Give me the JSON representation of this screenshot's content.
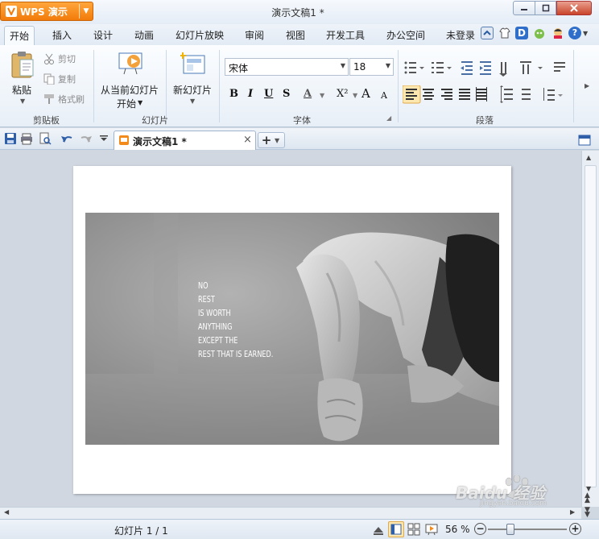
{
  "app": {
    "name": "WPS 演示",
    "doc_title": "演示文稿1 *"
  },
  "menu": {
    "tabs": [
      "开始",
      "插入",
      "设计",
      "动画",
      "幻灯片放映",
      "审阅",
      "视图",
      "开发工具",
      "办公空间"
    ],
    "login": "未登录"
  },
  "ribbon": {
    "clipboard": {
      "paste": "粘贴",
      "cut": "剪切",
      "copy": "复制",
      "format_painter": "格式刷",
      "group": "剪贴板"
    },
    "slides": {
      "from_current_1": "从当前幻灯片",
      "from_current_2": "开始",
      "new_slide": "新幻灯片",
      "group": "幻灯片"
    },
    "font": {
      "name": "宋体",
      "size": "18",
      "bold": "B",
      "italic": "I",
      "underline": "U",
      "strike": "S",
      "color_a": "A",
      "superscript": "X²",
      "grow": "A",
      "shrink": "A",
      "group": "字体"
    },
    "paragraph": {
      "group": "段落"
    }
  },
  "doc_tab": {
    "label": "演示文稿1 *",
    "close": "×",
    "new": "+"
  },
  "slide": {
    "quote_lines": [
      "NO",
      "REST",
      "IS WORTH",
      "ANYTHING",
      "EXCEPT THE",
      "REST THAT IS EARNED."
    ]
  },
  "status": {
    "slide_info": "幻灯片 1 / 1",
    "zoom": "56 %"
  },
  "watermark": {
    "text": "Baidu 经验",
    "sub": "jingyan.baidu.com"
  },
  "colors": {
    "accent": "#f28a1c",
    "ribbon_bg": "#eef3f9",
    "canvas_bg": "#d0d7e1"
  }
}
